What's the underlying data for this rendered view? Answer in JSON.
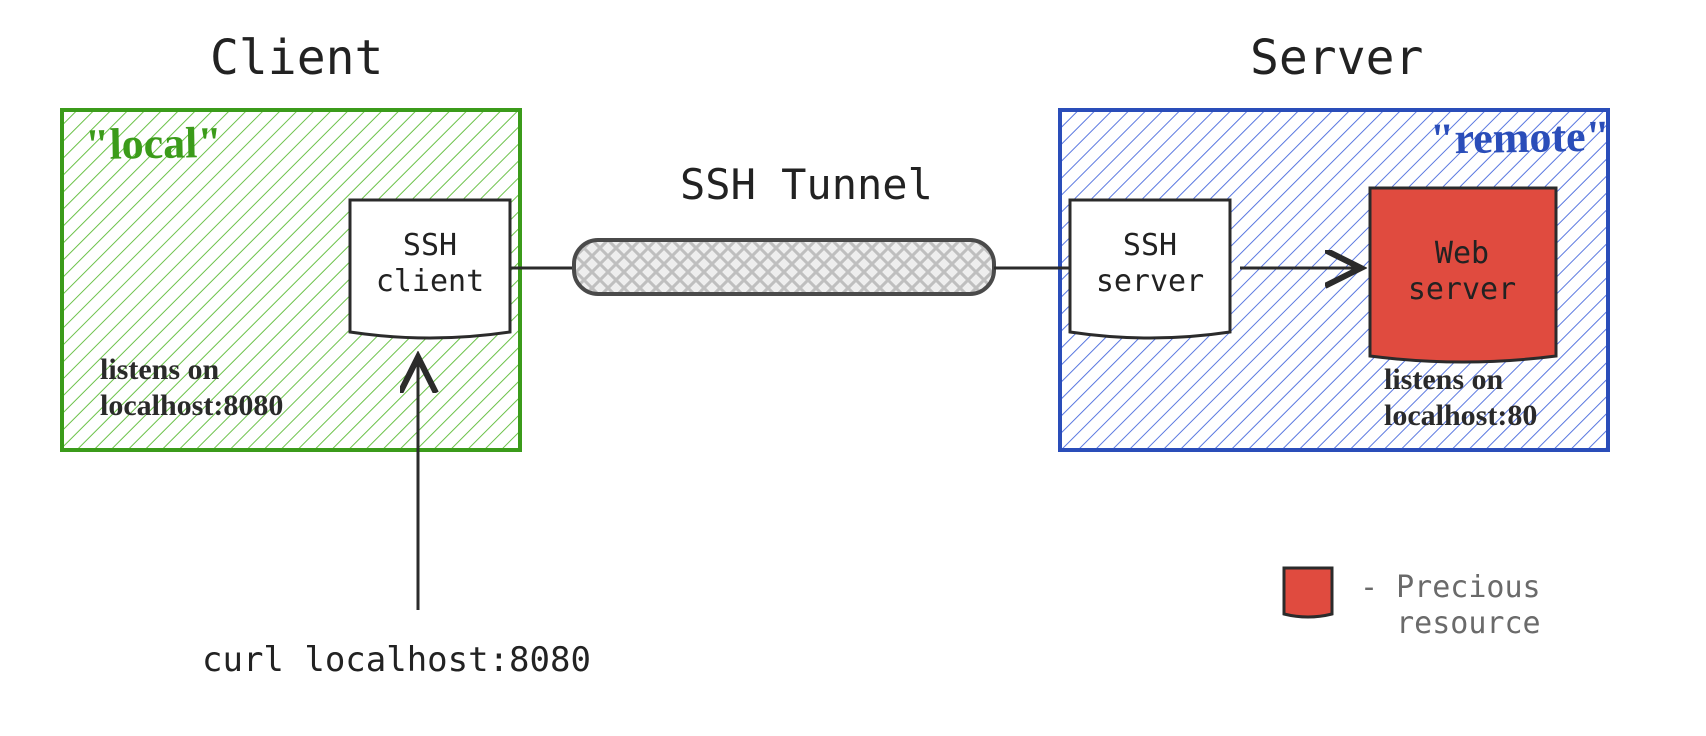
{
  "titles": {
    "client": "Client",
    "server": "Server",
    "tunnel": "SSH Tunnel"
  },
  "tags": {
    "local": "\"local\"",
    "remote": "\"remote\""
  },
  "nodes": {
    "ssh_client": "SSH\nclient",
    "ssh_server": "SSH\nserver",
    "web_server": "Web\nserver"
  },
  "annotations": {
    "listens_local_l1": "listens on",
    "listens_local_l2": "localhost:8080",
    "listens_remote_l1": "listens on",
    "listens_remote_l2": "localhost:80"
  },
  "curl": "curl localhost:8080",
  "legend": {
    "swatch": "precious-resource-swatch",
    "precious_l1": "- Precious",
    "precious_l2": "  resource"
  },
  "colors": {
    "green_stroke": "#3b9b1a",
    "blue_stroke": "#2a4db9",
    "red_fill": "#e04b3f",
    "tunnel_fill": "#cfcfcf",
    "ink": "#2b2b2b"
  }
}
